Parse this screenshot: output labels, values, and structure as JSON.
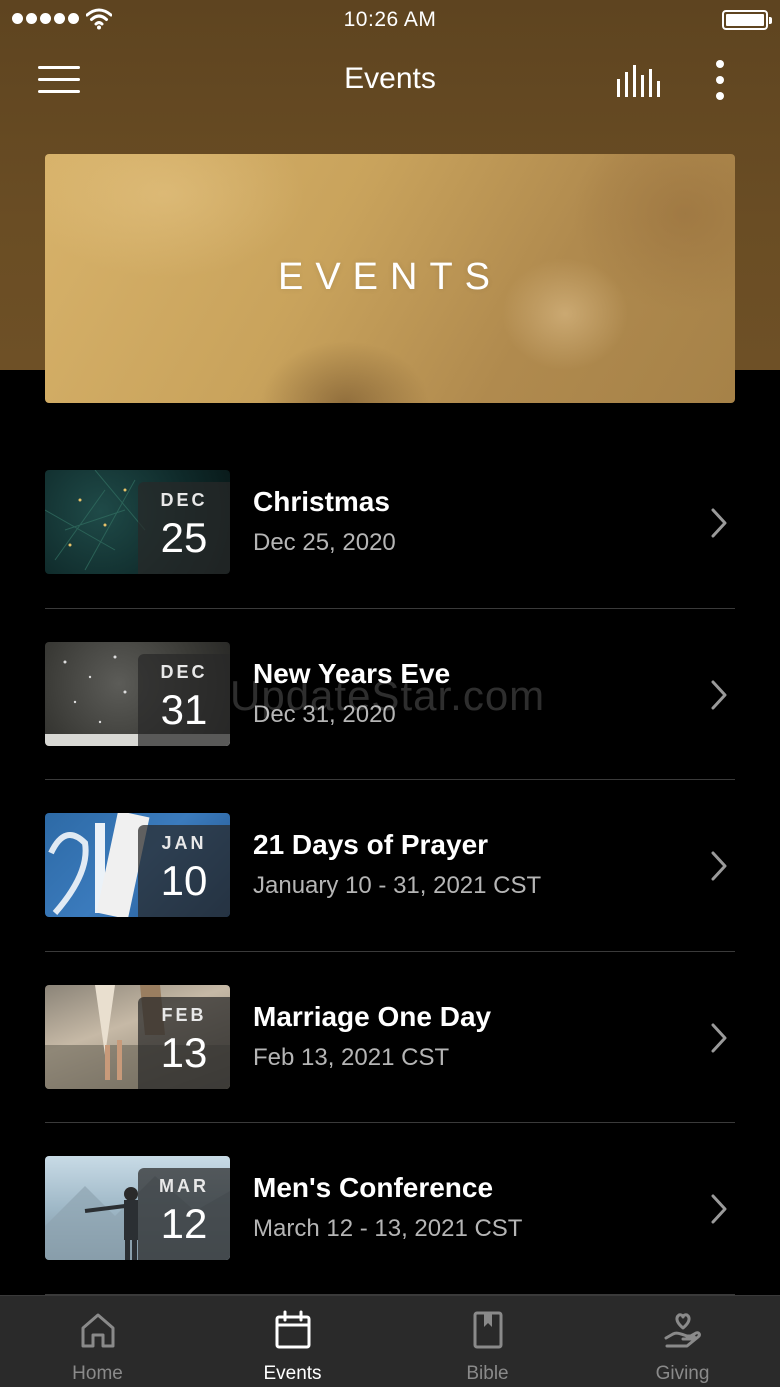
{
  "status_bar": {
    "time": "10:26 AM"
  },
  "nav": {
    "title": "Events"
  },
  "banner": {
    "title": "EVENTS"
  },
  "events": [
    {
      "month": "DEC",
      "day": "25",
      "title": "Christmas",
      "date": "Dec 25, 2020"
    },
    {
      "month": "DEC",
      "day": "31",
      "title": "New Years Eve",
      "date": "Dec 31, 2020"
    },
    {
      "month": "JAN",
      "day": "10",
      "title": "21 Days of Prayer",
      "date": "January 10 - 31, 2021 CST"
    },
    {
      "month": "FEB",
      "day": "13",
      "title": "Marriage One Day",
      "date": "Feb 13, 2021 CST"
    },
    {
      "month": "MAR",
      "day": "12",
      "title": "Men's Conference",
      "date": "March 12 - 13, 2021 CST"
    }
  ],
  "watermark": "UpdateStar.com",
  "tabs": [
    {
      "label": "Home",
      "icon": "home-icon",
      "active": false
    },
    {
      "label": "Events",
      "icon": "calendar-icon",
      "active": true
    },
    {
      "label": "Bible",
      "icon": "book-icon",
      "active": false
    },
    {
      "label": "Giving",
      "icon": "giving-hand-heart-icon",
      "active": false
    }
  ]
}
